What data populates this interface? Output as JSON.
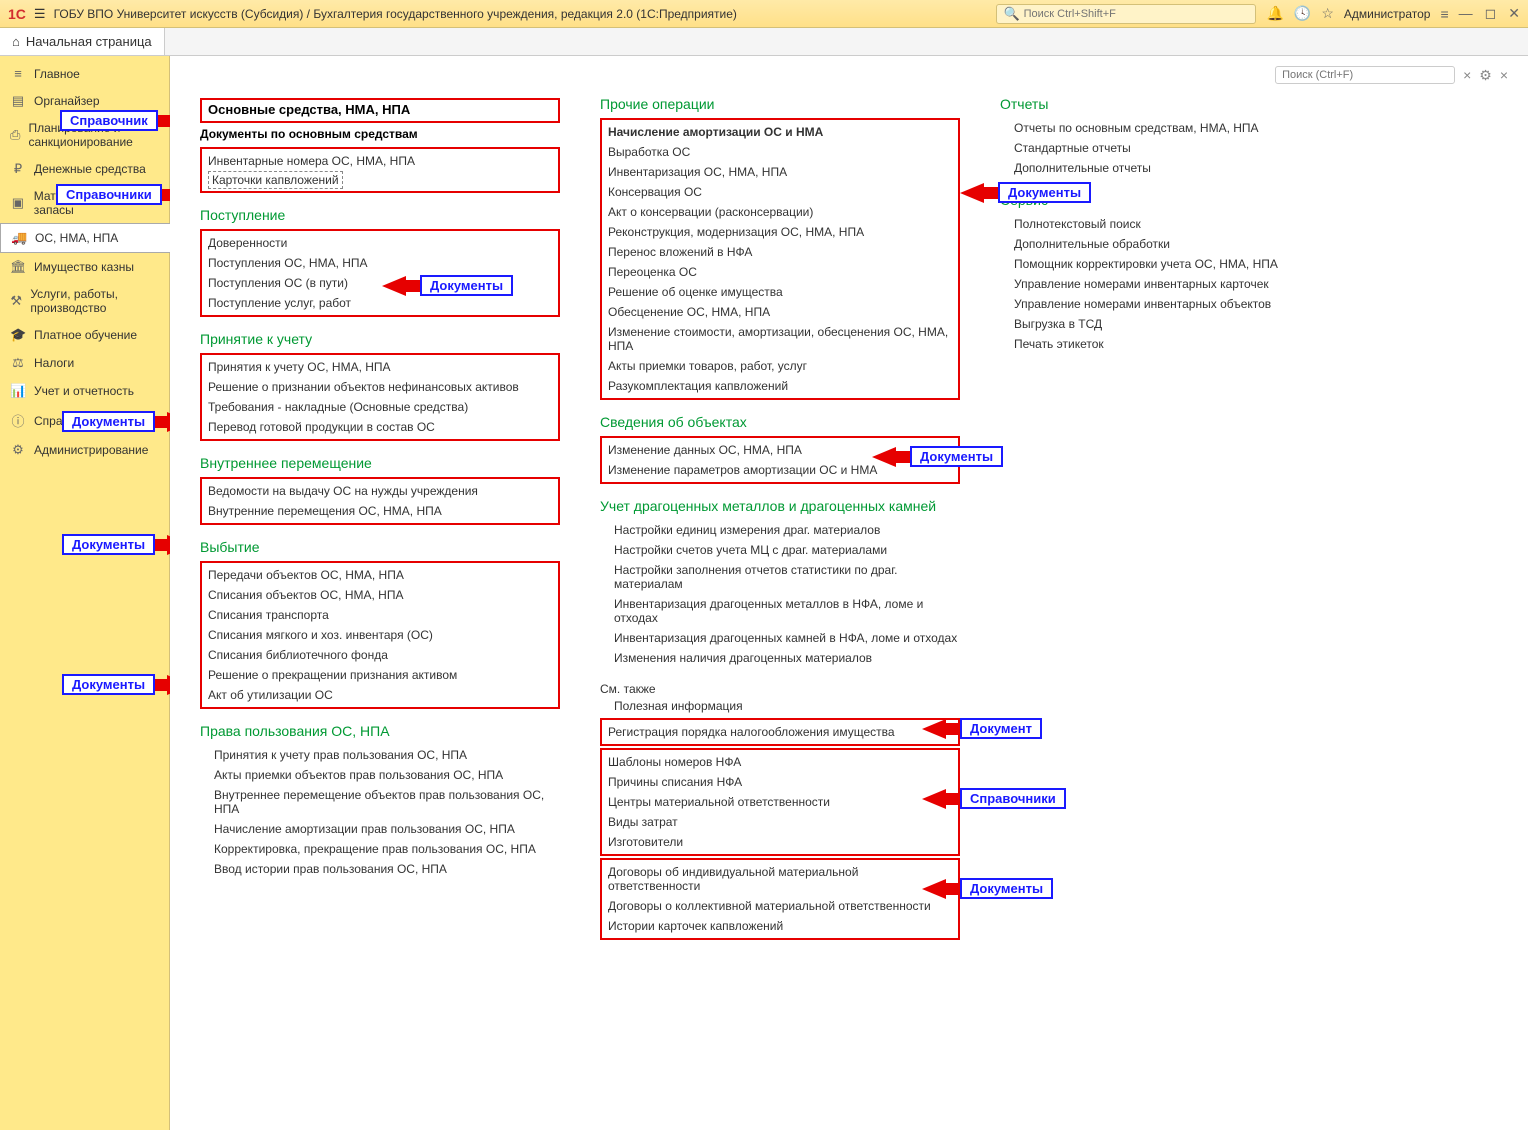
{
  "titlebar": {
    "app_logo": "1C",
    "title": "ГОБУ ВПО Университет искусств (Субсидия) / Бухгалтерия государственного учреждения, редакция 2.0  (1С:Предприятие)",
    "search_placeholder": "Поиск Ctrl+Shift+F",
    "user": "Администратор"
  },
  "tabs": {
    "home": "Начальная страница"
  },
  "sidebar": {
    "items": [
      "Главное",
      "Органайзер",
      "Планирование и санкционирование",
      "Денежные средства",
      "Материальные запасы",
      "ОС, НМА, НПА",
      "Имущество казны",
      "Услуги, работы, производство",
      "Платное обучение",
      "Налоги",
      "Учет и отчетность",
      "Справки",
      "Администрирование"
    ]
  },
  "content_search_placeholder": "Поиск (Ctrl+F)",
  "callouts": {
    "spravochnik": "Справочник",
    "spravochniki": "Справочники",
    "dokumenty": "Документы",
    "dokument": "Документ"
  },
  "col1": {
    "header_main": "Основные средства, НМА, НПА",
    "header_sub": "Документы по основным средствам",
    "docs1": [
      "Инвентарные номера ОС, НМА, НПА",
      "Карточки капвложений"
    ],
    "postuplenie_title": "Поступление",
    "postuplenie": [
      "Доверенности",
      "Поступления ОС, НМА, НПА",
      "Поступления ОС (в пути)",
      "Поступление услуг, работ"
    ],
    "prinyatie_title": "Принятие к учету",
    "prinyatie": [
      "Принятия к учету ОС, НМА, НПА",
      "Решение о признании объектов нефинансовых активов",
      "Требования - накладные (Основные средства)",
      "Перевод готовой продукции в состав ОС"
    ],
    "vnutr_title": "Внутреннее перемещение",
    "vnutr": [
      "Ведомости на выдачу ОС на нужды учреждения",
      "Внутренние перемещения ОС, НМА, НПА"
    ],
    "vybytie_title": "Выбытие",
    "vybytie": [
      "Передачи объектов ОС, НМА, НПА",
      "Списания объектов ОС, НМА, НПА",
      "Списания транспорта",
      "Списания мягкого и хоз. инвентаря (ОС)",
      "Списания библиотечного фонда",
      "Решение о прекращении признания активом",
      "Акт об утилизации ОС"
    ],
    "prava_title": "Права пользования ОС, НПА",
    "prava": [
      "Принятия к учету прав пользования ОС, НПА",
      "Акты приемки объектов прав пользования ОС, НПА",
      "Внутреннее перемещение объектов прав пользования ОС, НПА",
      "Начисление амортизации прав пользования ОС, НПА",
      "Корректировка, прекращение прав пользования ОС, НПА",
      "Ввод истории прав пользования ОС, НПА"
    ]
  },
  "col2": {
    "prochie_title": "Прочие операции",
    "prochie": [
      "Начисление амортизации ОС и НМА",
      "Выработка ОС",
      "Инвентаризация ОС, НМА, НПА",
      "Консервация ОС",
      "Акт о консервации (расконсервации)",
      "Реконструкция, модернизация ОС, НМА, НПА",
      "Перенос вложений в НФА",
      "Переоценка ОС",
      "Решение об оценке имущества",
      "Обесценение ОС, НМА, НПА",
      "Изменение стоимости, амортизации, обесценения ОС, НМА, НПА",
      "Акты приемки товаров, работ, услуг",
      "Разукомплектация капвложений"
    ],
    "svedeniya_title": "Сведения об объектах",
    "svedeniya": [
      "Изменение данных ОС, НМА, НПА",
      "Изменение параметров амортизации ОС и НМА"
    ],
    "dragmet_title": "Учет драгоценных металлов и драгоценных камней",
    "dragmet": [
      "Настройки единиц измерения драг. материалов",
      "Настройки счетов учета МЦ с драг. материалами",
      "Настройки заполнения отчетов статистики по драг. материалам",
      "Инвентаризация драгоценных металлов в НФА, ломе и отходах",
      "Инвентаризация драгоценных камней в НФА, ломе и отходах",
      "Изменения наличия драгоценных материалов"
    ],
    "see_also": "См. также",
    "see_also_items1": [
      "Полезная информация"
    ],
    "see_also_items2": [
      "Регистрация порядка налогообложения имущества"
    ],
    "see_also_items3": [
      "Шаблоны номеров НФА",
      "Причины списания НФА",
      "Центры материальной ответственности",
      "Виды затрат",
      "Изготовители"
    ],
    "see_also_items4": [
      "Договоры об индивидуальной материальной ответственности",
      "Договоры о коллективной материальной ответственности",
      "Истории карточек капвложений"
    ]
  },
  "col3": {
    "otchety_title": "Отчеты",
    "otchety": [
      "Отчеты по основным средствам, НМА, НПА",
      "Стандартные отчеты",
      "Дополнительные отчеты"
    ],
    "servis_title": "Сервис",
    "servis": [
      "Полнотекстовый поиск",
      "Дополнительные обработки",
      "Помощник корректировки учета ОС, НМА, НПА",
      "Управление номерами инвентарных карточек",
      "Управление номерами инвентарных объектов",
      "Выгрузка в ТСД",
      "Печать этикеток"
    ]
  }
}
